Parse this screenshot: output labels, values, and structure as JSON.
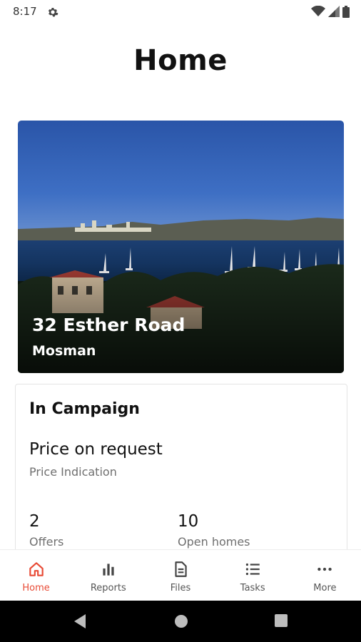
{
  "status_bar": {
    "time": "8:17",
    "icons": [
      "gear-icon",
      "wifi-icon",
      "signal-icon",
      "battery-icon"
    ]
  },
  "page": {
    "title": "Home"
  },
  "property": {
    "address": "32 Esther Road",
    "suburb": "Mosman",
    "image": "harbour-view-photo"
  },
  "campaign": {
    "title": "In Campaign",
    "price_value": "Price on request",
    "price_label": "Price Indication",
    "stats": [
      {
        "value": "2",
        "label": "Offers"
      },
      {
        "value": "10",
        "label": "Open homes"
      }
    ]
  },
  "bottom_nav": {
    "items": [
      {
        "label": "Home",
        "icon": "home-icon",
        "active": true
      },
      {
        "label": "Reports",
        "icon": "bar-chart-icon",
        "active": false
      },
      {
        "label": "Files",
        "icon": "file-icon",
        "active": false
      },
      {
        "label": "Tasks",
        "icon": "list-icon",
        "active": false
      },
      {
        "label": "More",
        "icon": "more-icon",
        "active": false
      }
    ]
  },
  "colors": {
    "accent": "#e84a35",
    "text": "#111111",
    "muted": "#6f6f6f"
  }
}
